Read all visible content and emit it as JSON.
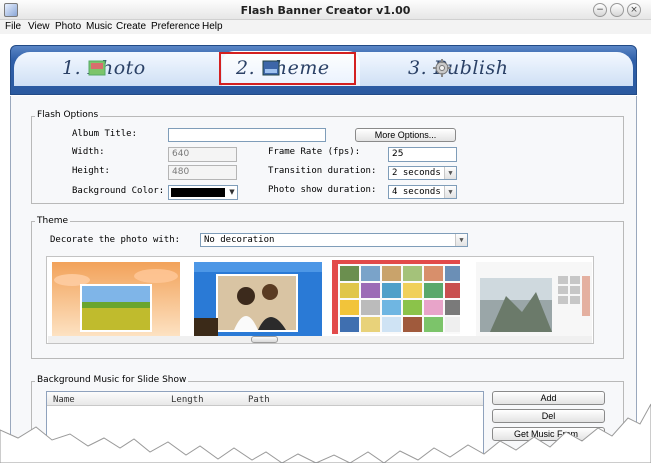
{
  "window": {
    "title": "Flash Banner Creator v1.00",
    "minimize_glyph": "−",
    "close_glyph": "×"
  },
  "menu": [
    "File",
    "View",
    "Photo",
    "Music",
    "Create",
    "Preference",
    "Help"
  ],
  "tabs": [
    {
      "label": "1. Photo",
      "icon": "photo-thumbnail-icon"
    },
    {
      "label": "2. Theme",
      "icon": "theme-thumbnail-icon"
    },
    {
      "label": "3. Publish",
      "icon": "gear-icon"
    }
  ],
  "active_tab": "2. Theme",
  "flash_options": {
    "group_label": "Flash Options",
    "album_title_label": "Album Title:",
    "album_title_value": "",
    "more_options_label": "More Options...",
    "width_label": "Width:",
    "width_value": "640",
    "height_label": "Height:",
    "height_value": "480",
    "bg_color_label": "Background Color:",
    "bg_color_value": "#000000",
    "frame_rate_label": "Frame Rate (fps):",
    "frame_rate_value": "25",
    "transition_label": "Transition duration:",
    "transition_value": "2 seconds",
    "photo_show_label": "Photo show duration:",
    "photo_show_value": "4 seconds"
  },
  "theme": {
    "group_label": "Theme",
    "decorate_label": "Decorate the photo with:",
    "decorate_value": "No decoration",
    "thumbnails": [
      "sunflower-field-theme",
      "wedding-couple-theme",
      "photo-grid-theme",
      "gallery-theme"
    ],
    "selected_thumbnail": "photo-grid-theme"
  },
  "music": {
    "group_label": "Background Music for Slide Show",
    "columns": [
      "Name",
      "Length",
      "Path"
    ],
    "add_label": "Add",
    "del_label": "Del",
    "get_music_label": "Get Music From"
  },
  "colors": {
    "header_blue": "#2f5fa8",
    "highlight_red": "#d42020"
  }
}
